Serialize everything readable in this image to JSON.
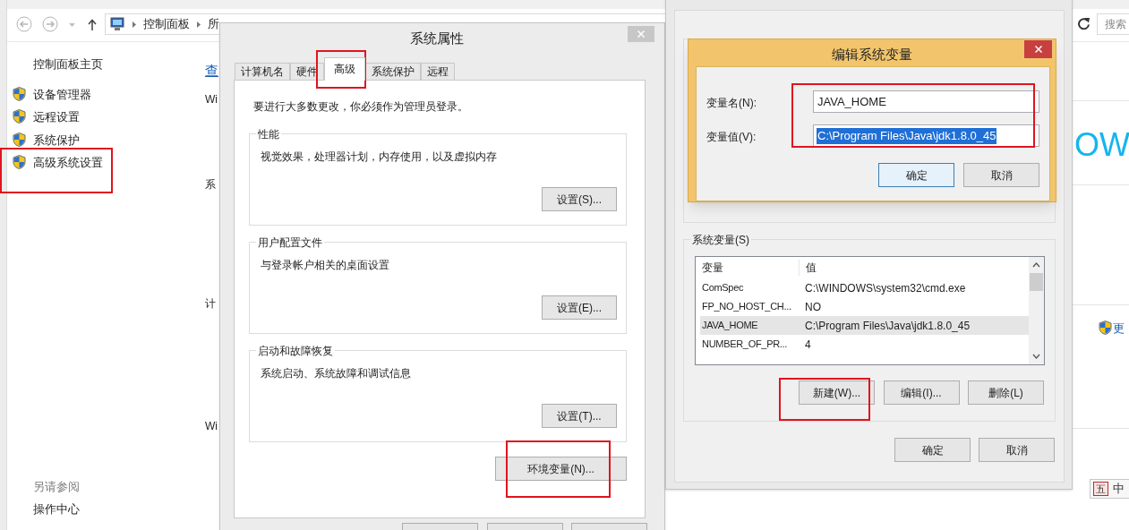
{
  "control_panel": {
    "breadcrumb": [
      "控制面板",
      "所"
    ],
    "search_placeholder": "搜索",
    "sidebar": {
      "home": "控制面板主页",
      "items": [
        "设备管理器",
        "远程设置",
        "系统保护",
        "高级系统设置"
      ],
      "see_also_title": "另请参阅",
      "see_also": [
        "操作中心"
      ]
    },
    "content_fragments": [
      {
        "kind": "link",
        "text": "查"
      },
      {
        "kind": "text",
        "text": "Wi"
      },
      {
        "kind": "text",
        "text": "系"
      },
      {
        "kind": "text",
        "text": "计"
      },
      {
        "kind": "text",
        "text": "Wi"
      }
    ],
    "banner_text": "OW",
    "side_link": "更"
  },
  "system_properties": {
    "title": "系统属性",
    "tabs": [
      {
        "label": "计算机名",
        "selected": false
      },
      {
        "label": "硬件",
        "selected": false
      },
      {
        "label": "高级",
        "selected": true
      },
      {
        "label": "系统保护",
        "selected": false
      },
      {
        "label": "远程",
        "selected": false
      }
    ],
    "admin_note": "要进行大多数更改，你必须作为管理员登录。",
    "groups": [
      {
        "title": "性能",
        "text": "视觉效果，处理器计划，内存使用，以及虚拟内存",
        "button": "设置(S)..."
      },
      {
        "title": "用户配置文件",
        "text": "与登录帐户相关的桌面设置",
        "button": "设置(E)..."
      },
      {
        "title": "启动和故障恢复",
        "text": "系统启动、系统故障和调试信息",
        "button": "设置(T)..."
      }
    ],
    "env_button": "环境变量(N)..."
  },
  "environment_variables": {
    "system_group_title": "系统变量(S)",
    "columns": [
      "变量",
      "值"
    ],
    "rows": [
      {
        "name": "ComSpec",
        "value": "C:\\WINDOWS\\system32\\cmd.exe",
        "selected": false
      },
      {
        "name": "FP_NO_HOST_CH...",
        "value": "NO",
        "selected": false
      },
      {
        "name": "JAVA_HOME",
        "value": "C:\\Program Files\\Java\\jdk1.8.0_45",
        "selected": true
      },
      {
        "name": "NUMBER_OF_PR...",
        "value": "4",
        "selected": false
      }
    ],
    "buttons": [
      "新建(W)...",
      "编辑(I)...",
      "删除(L)"
    ],
    "footer_buttons": [
      "确定",
      "取消"
    ]
  },
  "edit_dialog": {
    "title": "编辑系统变量",
    "fields": [
      {
        "label": "变量名(N):",
        "value": "JAVA_HOME",
        "value_selected": false
      },
      {
        "label": "变量值(V):",
        "value": "C:\\Program Files\\Java\\jdk1.8.0_45",
        "value_selected": true
      }
    ],
    "buttons": [
      {
        "label": "确定",
        "focused": true
      },
      {
        "label": "取消",
        "focused": false
      }
    ]
  },
  "ime": {
    "mode_icon": "五",
    "language": "中"
  }
}
